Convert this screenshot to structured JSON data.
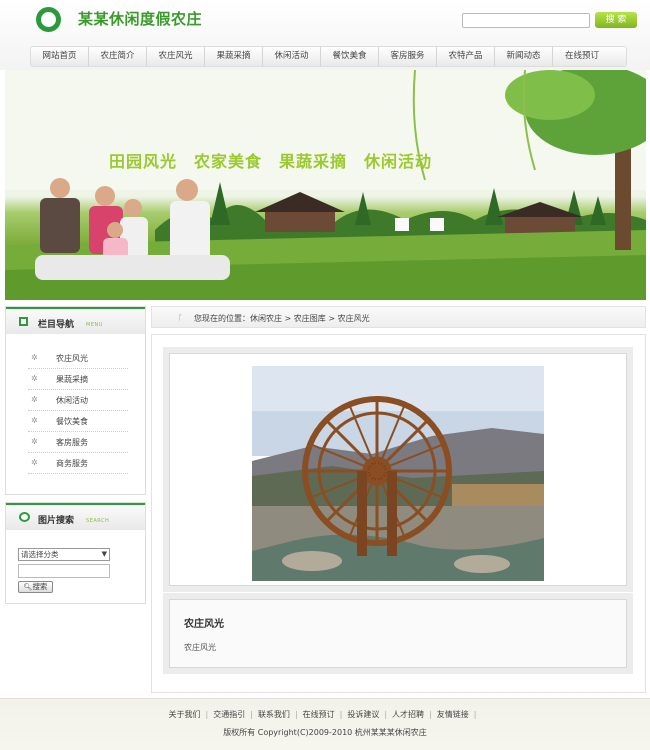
{
  "header": {
    "site_title": "某某休闲度假农庄",
    "search_placeholder": "",
    "search_button": "搜 索"
  },
  "nav": [
    "网站首页",
    "农庄简介",
    "农庄风光",
    "果蔬采摘",
    "休闲活动",
    "餐饮美食",
    "客房服务",
    "农特产品",
    "新闻动态",
    "在线预订"
  ],
  "banner": {
    "slogan": "田园风光　农家美食　果蔬采摘　休闲活动"
  },
  "sidebar": {
    "nav_box": {
      "title": "栏目导航",
      "subtitle": "MENU",
      "items": [
        "农庄风光",
        "果蔬采摘",
        "休闲活动",
        "餐饮美食",
        "客房服务",
        "商务服务"
      ]
    },
    "search_box": {
      "title": "图片搜索",
      "subtitle": "SEARCH",
      "select_value": "请选择分类",
      "search_button": "搜索"
    }
  },
  "breadcrumb": {
    "prefix": "您现在的位置：",
    "path": [
      "休闲农庄",
      "农庄图库",
      "农庄风光"
    ],
    "separator": " > "
  },
  "content": {
    "title": "农庄风光",
    "description": "农庄风光"
  },
  "footer": {
    "links": [
      "关于我们",
      "交通指引",
      "联系我们",
      "在线预订",
      "投诉建议",
      "人才招聘",
      "友情链接"
    ],
    "copyright": "版权所有  Copyright(C)2009-2010 杭州某某某休闲农庄"
  },
  "colors": {
    "brand_green": "#2b9a3c",
    "accent_lime": "#9cc92f"
  }
}
